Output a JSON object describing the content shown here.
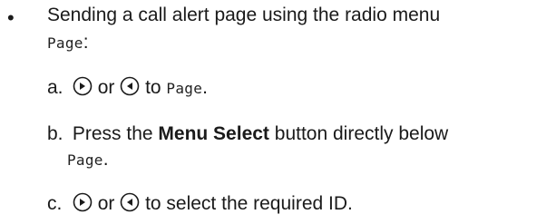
{
  "intro": {
    "bullet": "•",
    "line1": "Sending a call alert page using the radio menu",
    "menu_item": "Page",
    "colon": ":"
  },
  "steps": [
    {
      "marker": "a.",
      "or": "or",
      "to": "to",
      "menu_item": "Page",
      "end": "."
    },
    {
      "marker": "b.",
      "text1": "Press the ",
      "bold": "Menu Select",
      "text2": " button directly below",
      "menu_item": "Page",
      "end": "."
    },
    {
      "marker": "c.",
      "or": "or",
      "text": "to select the required ID."
    }
  ],
  "icons": {
    "right": "right-navigation-key-icon",
    "left": "left-navigation-key-icon"
  }
}
